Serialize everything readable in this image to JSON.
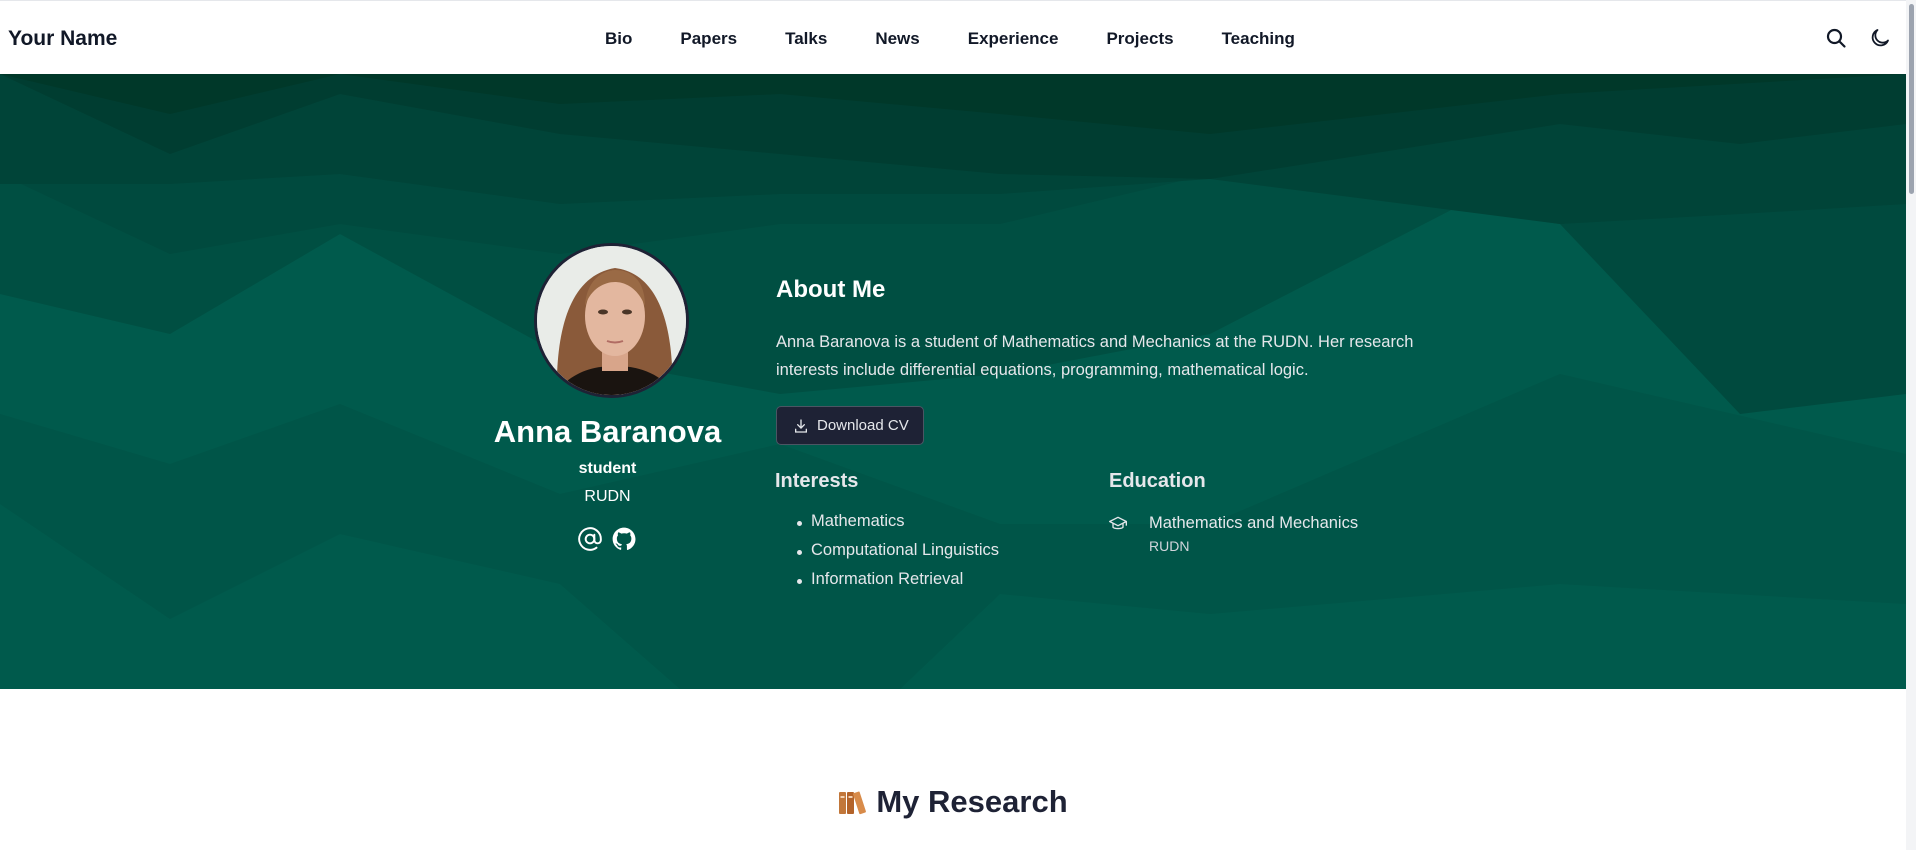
{
  "navbar": {
    "brand": "Your Name",
    "links": [
      "Bio",
      "Papers",
      "Talks",
      "News",
      "Experience",
      "Projects",
      "Teaching"
    ],
    "icons": [
      "search-icon",
      "moon-icon"
    ]
  },
  "profile": {
    "name": "Anna Baranova",
    "role": "student",
    "organization": "RUDN",
    "social_icons": [
      "at-sign-icon",
      "github-icon"
    ]
  },
  "about": {
    "title": "About Me",
    "text": "Anna Baranova is a student of Mathematics and Mechanics at the RUDN. Her research interests include differential equations, programming, mathematical logic.",
    "cv_button": "Download CV"
  },
  "interests": {
    "title": "Interests",
    "items": [
      "Mathematics",
      "Computational Linguistics",
      "Information Retrieval"
    ]
  },
  "education": {
    "title": "Education",
    "degree": "Mathematics and Mechanics",
    "institution": "RUDN"
  },
  "research": {
    "title": "My Research",
    "icon": "books-icon"
  },
  "colors": {
    "hero_base": "#005a4c",
    "hero_dark": "#003829",
    "button_bg": "#1e2235",
    "heading_dark": "#1e2235"
  }
}
